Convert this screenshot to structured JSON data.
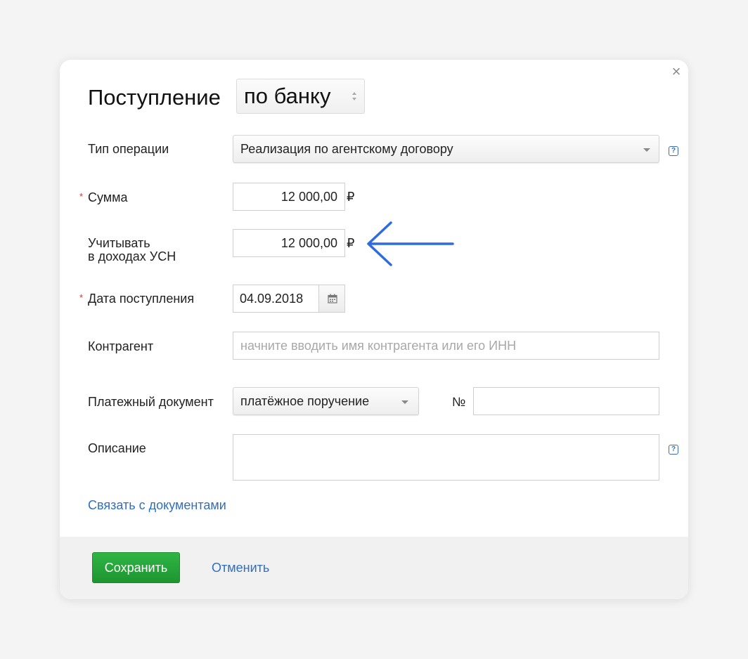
{
  "dialog": {
    "title": "Поступление",
    "title_select": "по банку",
    "close_label": "×"
  },
  "form": {
    "operation_type": {
      "label": "Тип операции",
      "value": "Реализация по агентскому договору"
    },
    "amount": {
      "label": "Сумма",
      "value": "12 000,00",
      "currency": "₽",
      "required_mark": "*"
    },
    "usn_income": {
      "label_line1": "Учитывать",
      "label_line2": "в доходах УСН",
      "value": "12 000,00",
      "currency": "₽"
    },
    "receipt_date": {
      "label": "Дата поступления",
      "value": "04.09.2018",
      "required_mark": "*"
    },
    "counterparty": {
      "label": "Контрагент",
      "placeholder": "начните вводить имя контрагента или его ИНН"
    },
    "payment_document": {
      "label": "Платежный документ",
      "value": "платёжное поручение",
      "number_label": "№",
      "number_value": ""
    },
    "description": {
      "label": "Описание",
      "value": ""
    },
    "help_glyph": "?",
    "link_documents": "Связать с документами"
  },
  "footer": {
    "save_label": "Сохранить",
    "cancel_label": "Отменить"
  },
  "colors": {
    "accent_green": "#23a33a",
    "link_blue": "#2f6fc2",
    "arrow_blue": "#2f6be0",
    "required_red": "#d9342b"
  }
}
